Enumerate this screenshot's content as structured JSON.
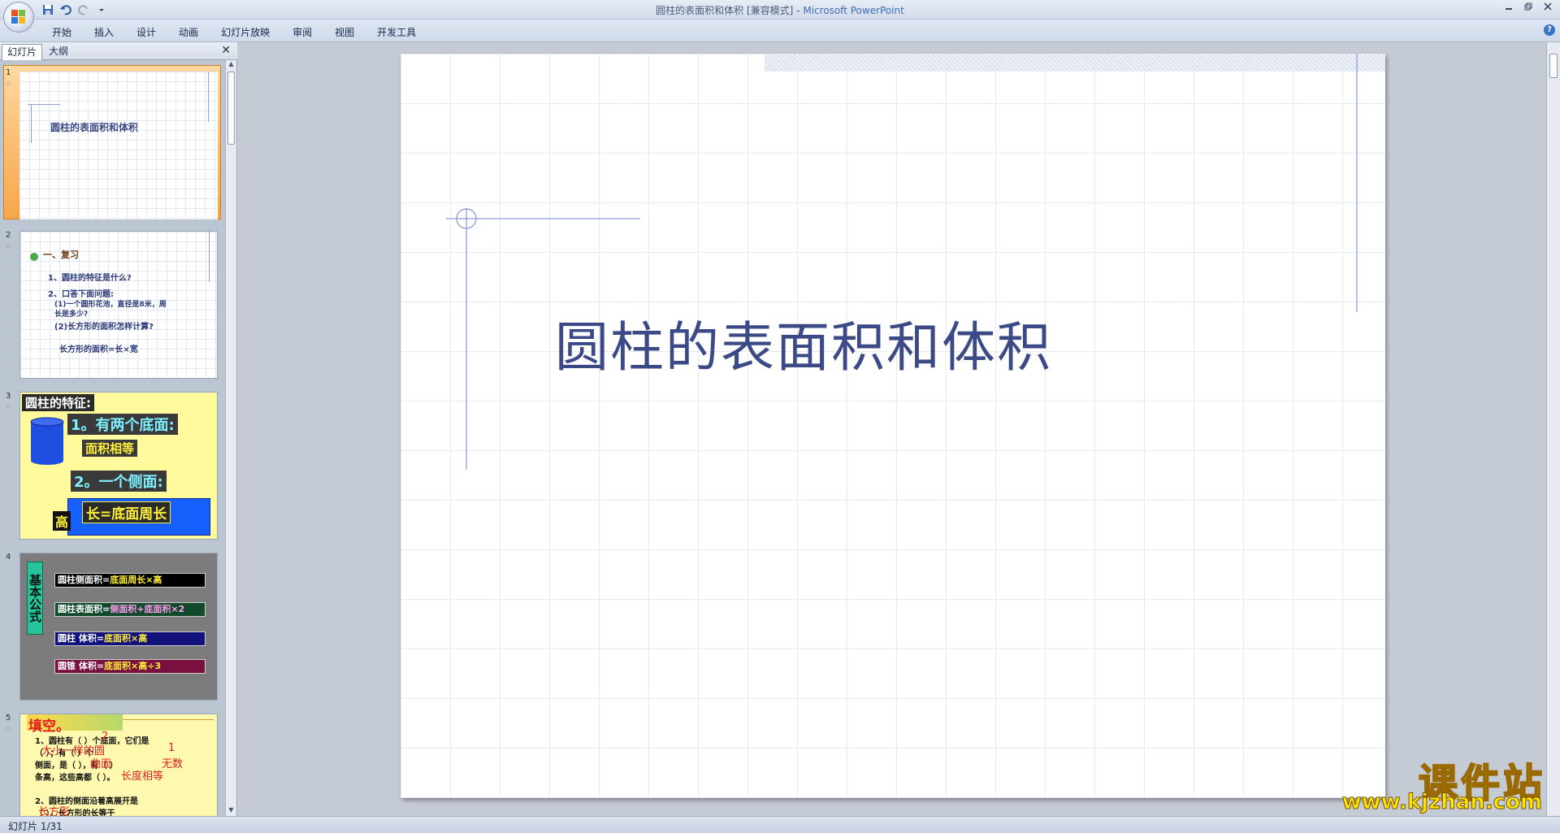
{
  "window": {
    "title": "圆柱的表面积和体积 [兼容模式] - ",
    "app_name": "Microsoft PowerPoint",
    "controls": [
      "minimize-icon",
      "restore-icon",
      "close-icon"
    ]
  },
  "quick_access": [
    "save-icon",
    "undo-icon",
    "redo-icon",
    "customize-icon"
  ],
  "ribbon_tabs": [
    "开始",
    "插入",
    "设计",
    "动画",
    "幻灯片放映",
    "审阅",
    "视图",
    "开发工具"
  ],
  "panel": {
    "tabs": [
      "幻灯片",
      "大纲"
    ],
    "close": "✕"
  },
  "thumbnails": [
    {
      "number": "1",
      "title": "圆柱的表面积和体积"
    },
    {
      "number": "2",
      "heading": "一、复习",
      "lines": [
        "1、圆柱的特征是什么?",
        "2、口答下面问题:",
        "(1)一个圆形花池，直径是8米，周",
        "长是多少?",
        "(2)长方形的面积怎样计算?",
        "长方形的面积=长×宽"
      ]
    },
    {
      "number": "3",
      "heading": "圆柱的特征:",
      "lines": [
        "1。有两个底面:",
        "面积相等",
        "2。一个侧面:",
        "长=底面周长",
        "高"
      ]
    },
    {
      "number": "4",
      "side_label": "基本公式",
      "formulas": [
        {
          "left": "圆柱侧面积=",
          "right": "底面周长×高"
        },
        {
          "left": "圆柱表面积=",
          "right": "侧面积+底面积×2"
        },
        {
          "left": "圆柱 体积=",
          "right": "底面积×高"
        },
        {
          "left": "圆锥 体积=",
          "right": "底面积×高÷3"
        }
      ]
    },
    {
      "number": "5",
      "heading": "填空。",
      "lines": [
        "1、圆柱有（  ）个底面，它们是",
        "（            ）；有（  ）个",
        "侧面，是（    ），有（    ）",
        "条高，这些高都（          ）。",
        "2、圆柱的侧面沿着高展开是",
        "（      ），长方形的长等于"
      ],
      "answers": [
        "2",
        "大小一样的圆",
        "1",
        "曲面",
        "无数",
        "长度相等",
        "长方形"
      ]
    }
  ],
  "slide": {
    "title": "圆柱的表面积和体积"
  },
  "status": {
    "text": "幻灯片 1/31"
  },
  "watermark": {
    "title": "课件站",
    "url": "www.kjzhan.com"
  }
}
